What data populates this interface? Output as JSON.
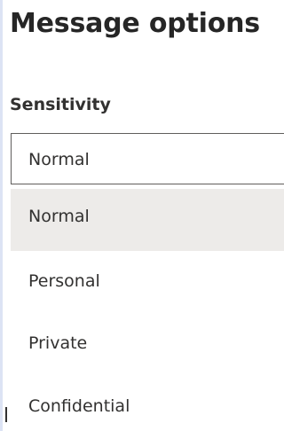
{
  "panel": {
    "title": "Message options"
  },
  "sensitivity": {
    "label": "Sensitivity",
    "selected_value": "Normal",
    "options": [
      {
        "label": "Normal",
        "selected": true
      },
      {
        "label": "Personal",
        "selected": false
      },
      {
        "label": "Private",
        "selected": false
      },
      {
        "label": "Confidential",
        "selected": false
      }
    ]
  },
  "colors": {
    "selected_option_bg": "#edebe9",
    "border": "#605e5c",
    "text": "#323130"
  }
}
